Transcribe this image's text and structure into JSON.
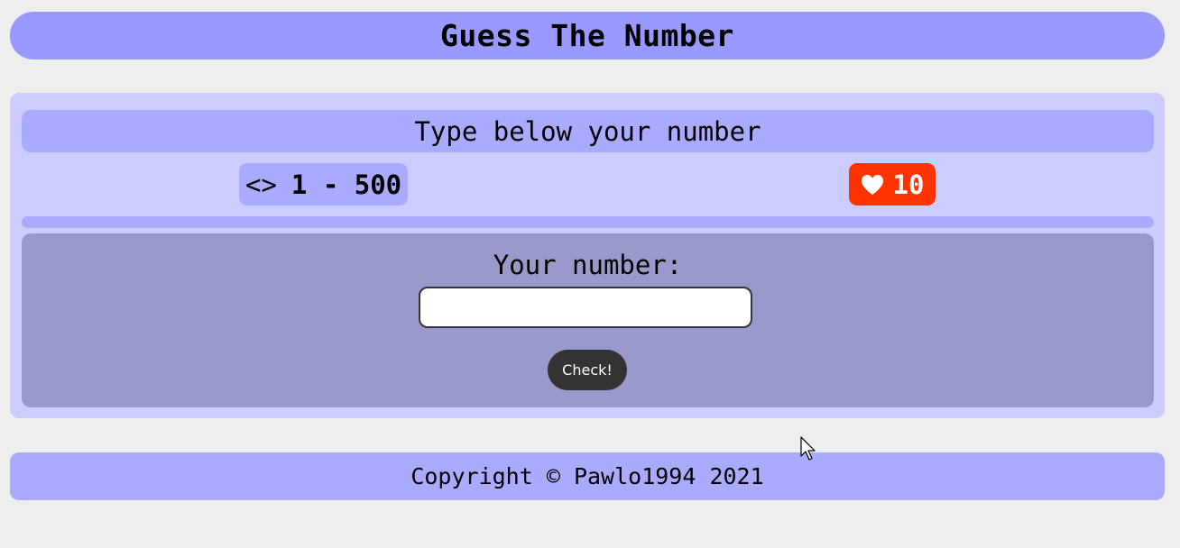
{
  "header": {
    "title": "Guess The Number"
  },
  "game": {
    "instruction": "Type below your number",
    "range_icon": "<>",
    "range_text": "1 - 500",
    "lives_icon": "heart-icon",
    "lives_count": "10",
    "message": "",
    "input_label": "Your number:",
    "input_value": "",
    "check_label": "Check!"
  },
  "footer": {
    "copyright": "Copyright © Pawlo1994 2021"
  },
  "colors": {
    "page_background": "#eeeeee",
    "header_background": "#9999ff",
    "panel_background": "#ccccff",
    "accent_light": "#aaaaff",
    "input_panel": "#9999cc",
    "lives_badge": "#ff3300",
    "button": "#333333"
  }
}
